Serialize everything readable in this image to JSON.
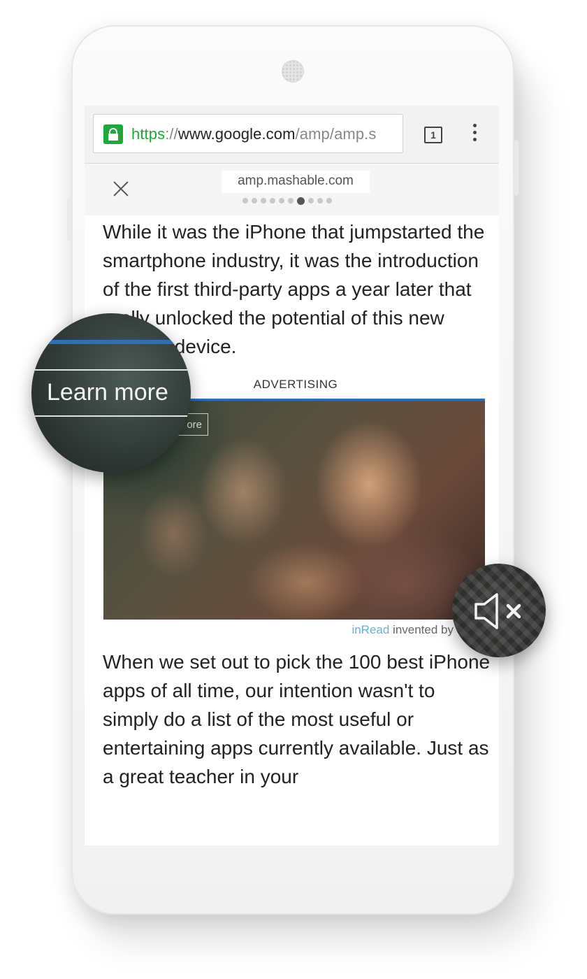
{
  "browser": {
    "url_scheme": "https",
    "url_separator": "://",
    "url_host": "www.google.com",
    "url_path": "/amp/amp.s",
    "tab_count": "1"
  },
  "amp_viewer": {
    "domain": "amp.mashable.com",
    "carousel_dots": 10,
    "active_dot": 6
  },
  "article": {
    "paragraph1_visible": "While it was the iPhone that jumpstarted the smartphone industry, it was the introduction of the first third-party apps a year later that really unlocked the potential of this new class of device.",
    "paragraph2": "When we set out to pick the 100 best iPhone apps of all time, our intention wasn't to simply do a list of the most useful or entertaining apps currently available. Just as a great teacher in your"
  },
  "ad": {
    "label": "ADVERTISING",
    "learn_more_partial": "ore",
    "footer_brand": "inRead",
    "footer_text": " invented by"
  },
  "zoom": {
    "learn_more": "Learn more",
    "mute_icon": "speaker-muted-icon"
  },
  "colors": {
    "secure_green": "#1fa83a",
    "ad_border_blue": "#2e6fb8",
    "inread_blue": "#6ab0d6"
  }
}
